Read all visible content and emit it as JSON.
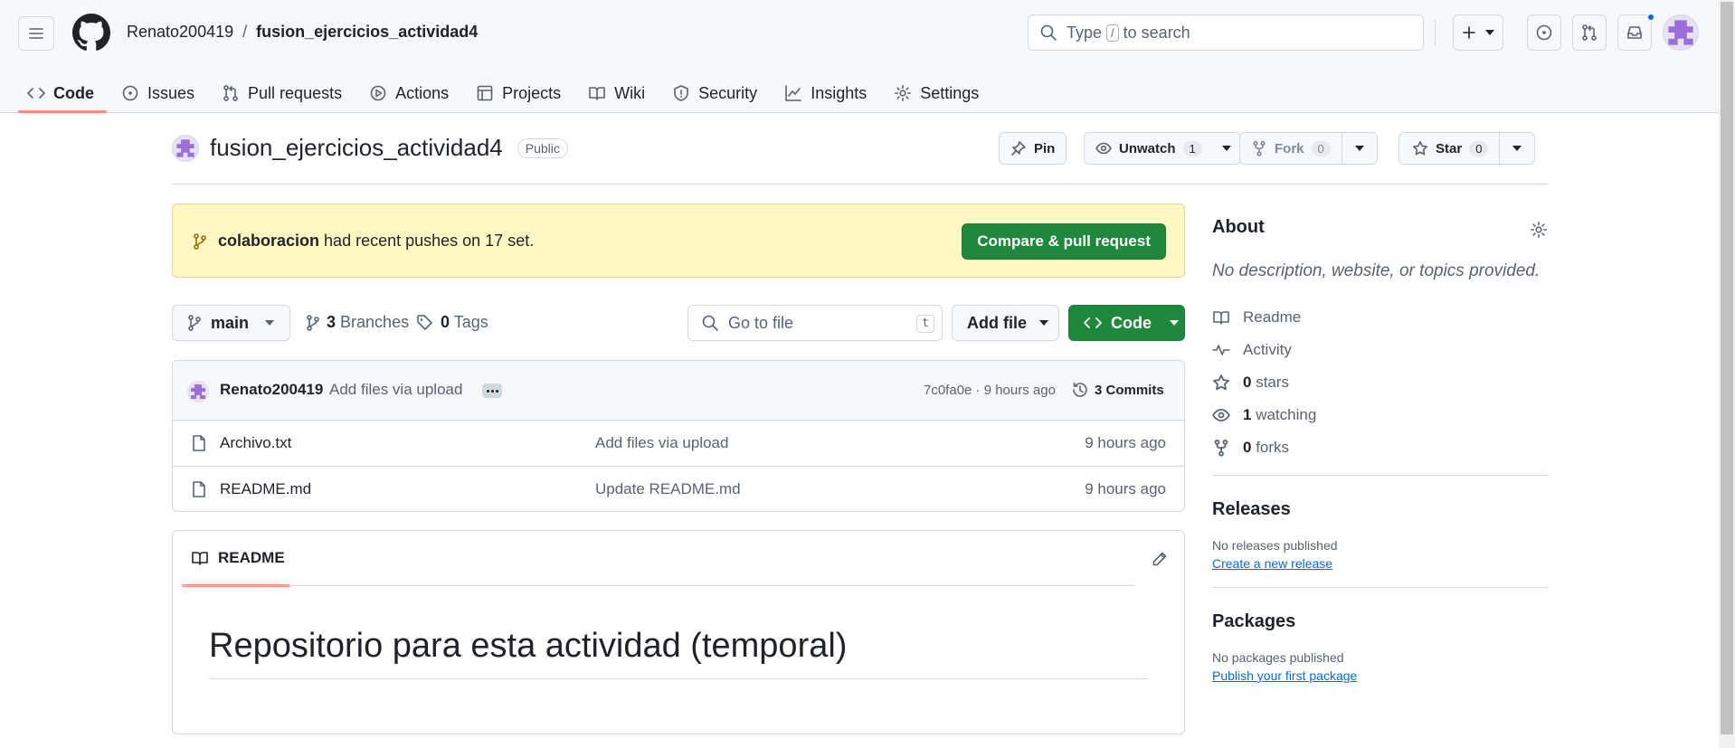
{
  "header": {
    "owner": "Renato200419",
    "separator": "/",
    "repo": "fusion_ejercicios_actividad4",
    "search_prefix": "Type",
    "search_key": "/",
    "search_suffix": "to search"
  },
  "tabs": [
    {
      "label": "Code",
      "icon": "code-icon",
      "active": true
    },
    {
      "label": "Issues",
      "icon": "issue-icon"
    },
    {
      "label": "Pull requests",
      "icon": "pull-request-icon"
    },
    {
      "label": "Actions",
      "icon": "play-icon"
    },
    {
      "label": "Projects",
      "icon": "table-icon"
    },
    {
      "label": "Wiki",
      "icon": "book-icon"
    },
    {
      "label": "Security",
      "icon": "shield-icon"
    },
    {
      "label": "Insights",
      "icon": "graph-icon"
    },
    {
      "label": "Settings",
      "icon": "gear-icon"
    }
  ],
  "repo_header": {
    "title": "fusion_ejercicios_actividad4",
    "visibility": "Public",
    "pin_label": "Pin",
    "unwatch_label": "Unwatch",
    "watch_count": "1",
    "fork_label": "Fork",
    "fork_count": "0",
    "star_label": "Star",
    "star_count": "0"
  },
  "banner": {
    "branch": "colaboracion",
    "text": "had recent pushes on 17 set.",
    "button": "Compare & pull request"
  },
  "branch_bar": {
    "branch": "main",
    "branches_count": "3",
    "branches_label": "Branches",
    "tags_count": "0",
    "tags_label": "Tags",
    "goto_placeholder": "Go to file",
    "goto_key": "t",
    "add_file": "Add file",
    "code": "Code"
  },
  "latest_commit": {
    "author": "Renato200419",
    "message": "Add files via upload",
    "meta": "7c0fa0e · 9 hours ago",
    "commits": "3 Commits"
  },
  "files": [
    {
      "name": "Archivo.txt",
      "message": "Add files via upload",
      "age": "9 hours ago"
    },
    {
      "name": "README.md",
      "message": "Update README.md",
      "age": "9 hours ago"
    }
  ],
  "readme": {
    "tab": "README",
    "heading": "Repositorio para esta actividad (temporal)"
  },
  "about": {
    "title": "About",
    "description": "No description, website, or topics provided.",
    "readme": "Readme",
    "activity": "Activity",
    "stars_count": "0",
    "stars_label": "stars",
    "watching_count": "1",
    "watching_label": "watching",
    "forks_count": "0",
    "forks_label": "forks"
  },
  "releases": {
    "title": "Releases",
    "empty": "No releases published",
    "link": "Create a new release"
  },
  "packages": {
    "title": "Packages",
    "empty": "No packages published",
    "link": "Publish your first package"
  },
  "colors": {
    "accent_green": "#1f883d",
    "link_blue": "#0969da",
    "tab_underline": "#fd8c73",
    "banner_bg": "#fff8c5"
  }
}
